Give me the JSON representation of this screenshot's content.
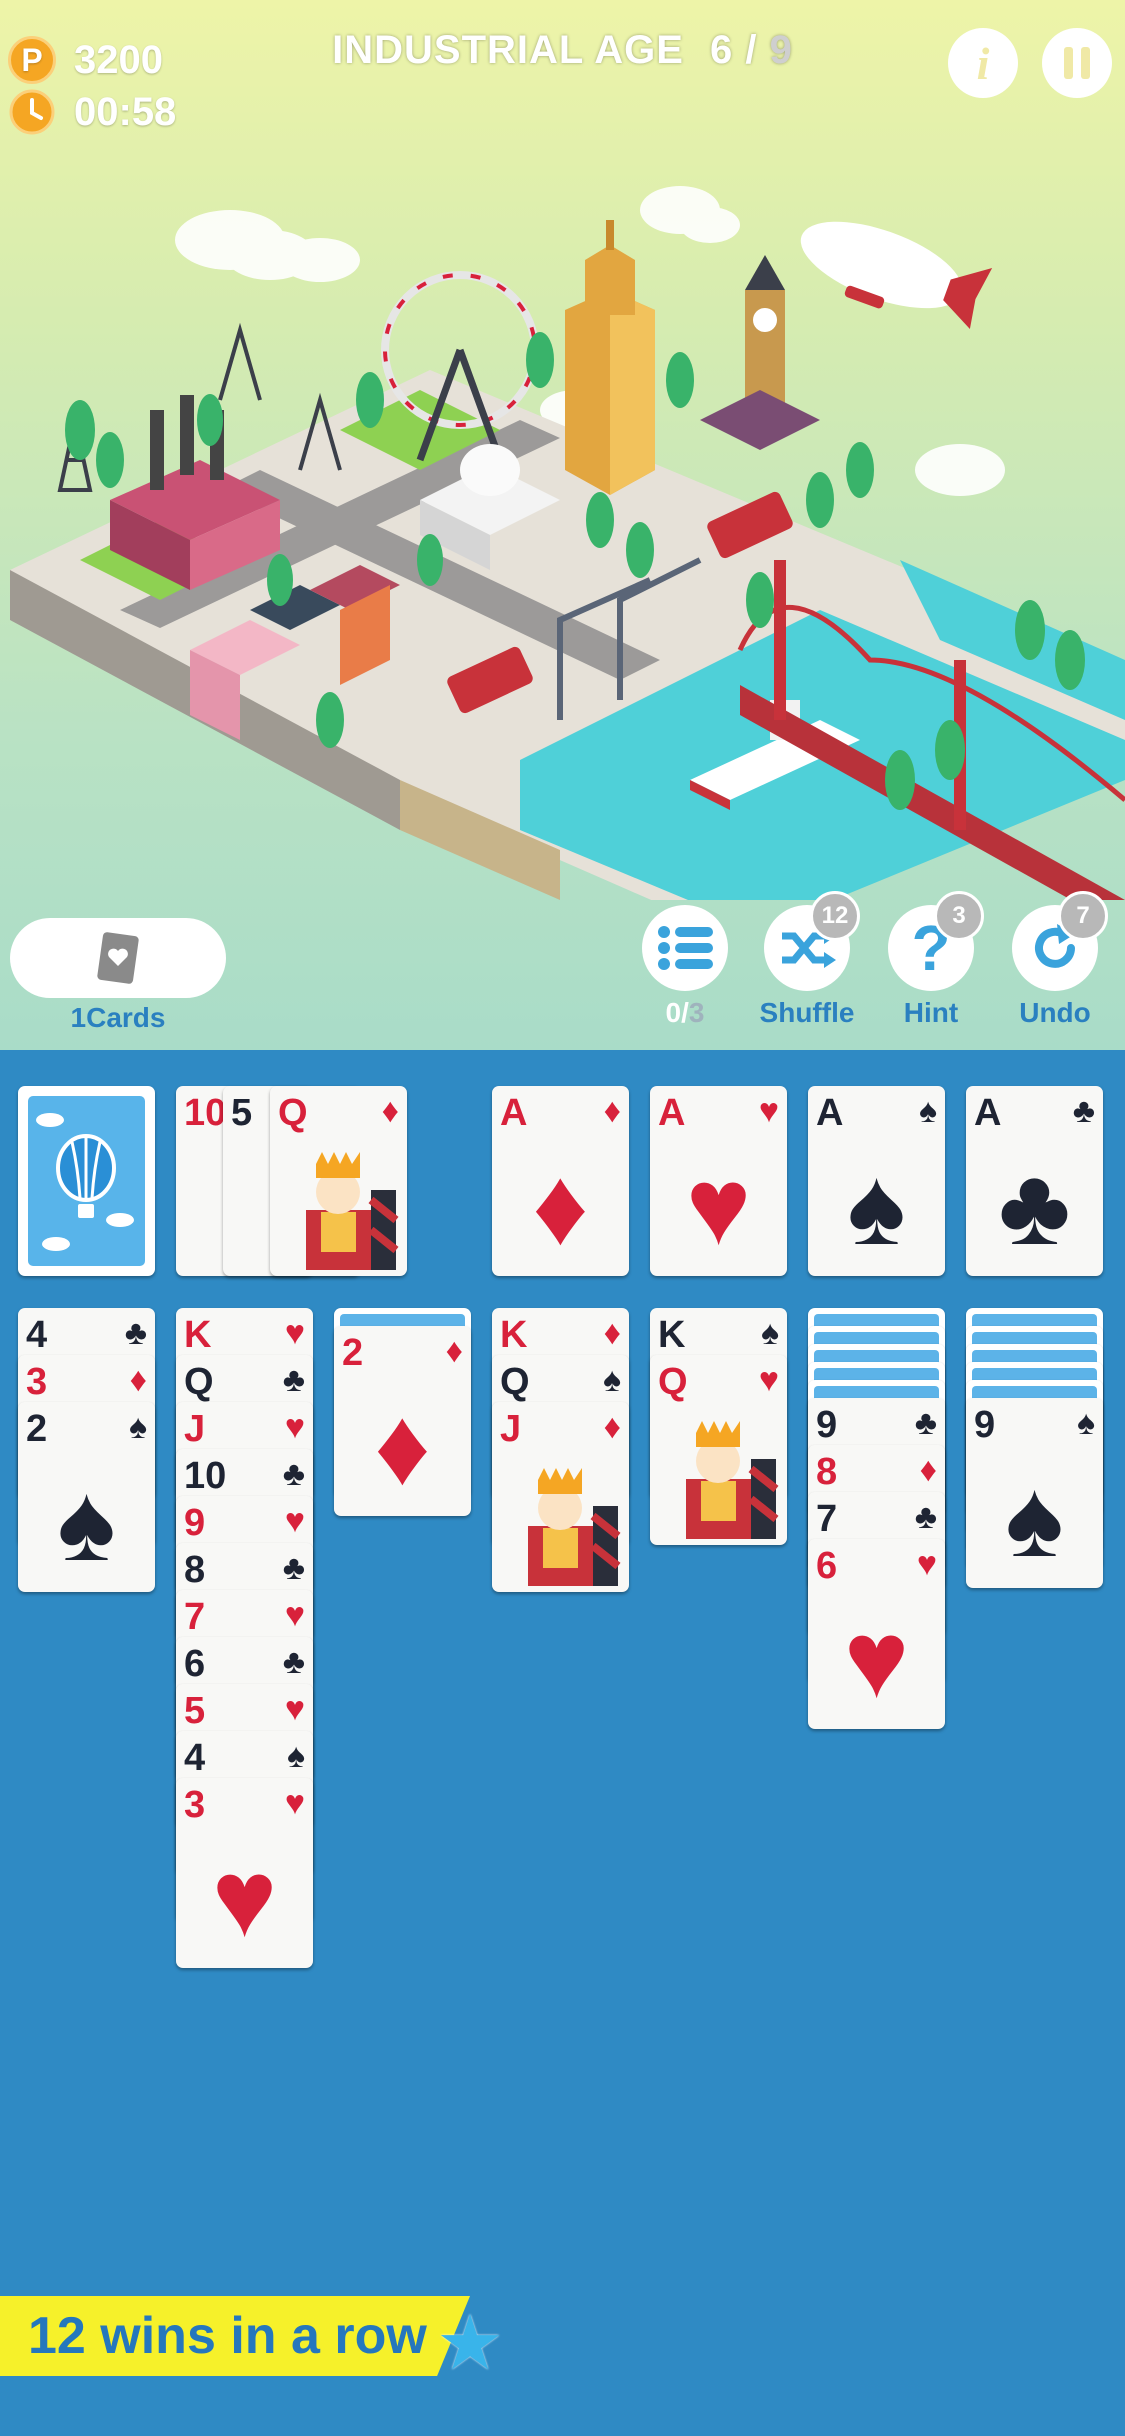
{
  "hud": {
    "coin_icon": "P",
    "coins": "3200",
    "timer": "00:58",
    "level_name": "INDUSTRIAL AGE",
    "level_current": "6",
    "level_sep": " / ",
    "level_total": "9"
  },
  "toolbar": {
    "cards_label": "1Cards",
    "goals_count": "0",
    "goals_sep": "/",
    "goals_total": "3",
    "shuffle_label": "Shuffle",
    "shuffle_badge": "12",
    "hint_label": "Hint",
    "hint_badge": "3",
    "undo_label": "Undo",
    "undo_badge": "7"
  },
  "waste": [
    {
      "rank": "10",
      "suit": "♦",
      "color": "red"
    },
    {
      "rank": "5",
      "suit": "♠",
      "color": "blk"
    },
    {
      "rank": "Q",
      "suit": "♦",
      "color": "red"
    }
  ],
  "foundations": [
    {
      "rank": "A",
      "suit": "♦",
      "color": "red"
    },
    {
      "rank": "A",
      "suit": "♥",
      "color": "red"
    },
    {
      "rank": "A",
      "suit": "♠",
      "color": "blk"
    },
    {
      "rank": "A",
      "suit": "♣",
      "color": "blk"
    }
  ],
  "tableau": [
    {
      "hidden": 0,
      "cards": [
        {
          "rank": "4",
          "suit": "♣",
          "color": "blk"
        },
        {
          "rank": "3",
          "suit": "♦",
          "color": "red"
        },
        {
          "rank": "2",
          "suit": "♠",
          "color": "blk"
        }
      ]
    },
    {
      "hidden": 0,
      "cards": [
        {
          "rank": "K",
          "suit": "♥",
          "color": "red"
        },
        {
          "rank": "Q",
          "suit": "♣",
          "color": "blk"
        },
        {
          "rank": "J",
          "suit": "♥",
          "color": "red"
        },
        {
          "rank": "10",
          "suit": "♣",
          "color": "blk"
        },
        {
          "rank": "9",
          "suit": "♥",
          "color": "red"
        },
        {
          "rank": "8",
          "suit": "♣",
          "color": "blk"
        },
        {
          "rank": "7",
          "suit": "♥",
          "color": "red"
        },
        {
          "rank": "6",
          "suit": "♣",
          "color": "blk"
        },
        {
          "rank": "5",
          "suit": "♥",
          "color": "red"
        },
        {
          "rank": "4",
          "suit": "♠",
          "color": "blk"
        },
        {
          "rank": "3",
          "suit": "♥",
          "color": "red"
        }
      ]
    },
    {
      "hidden": 1,
      "cards": [
        {
          "rank": "2",
          "suit": "♦",
          "color": "red"
        }
      ]
    },
    {
      "hidden": 0,
      "cards": [
        {
          "rank": "K",
          "suit": "♦",
          "color": "red"
        },
        {
          "rank": "Q",
          "suit": "♠",
          "color": "blk"
        },
        {
          "rank": "J",
          "suit": "♦",
          "color": "red"
        }
      ]
    },
    {
      "hidden": 0,
      "cards": [
        {
          "rank": "K",
          "suit": "♠",
          "color": "blk"
        },
        {
          "rank": "Q",
          "suit": "♥",
          "color": "red"
        }
      ]
    },
    {
      "hidden": 5,
      "cards": [
        {
          "rank": "9",
          "suit": "♣",
          "color": "blk"
        },
        {
          "rank": "8",
          "suit": "♦",
          "color": "red"
        },
        {
          "rank": "7",
          "suit": "♣",
          "color": "blk"
        },
        {
          "rank": "6",
          "suit": "♥",
          "color": "red"
        }
      ]
    },
    {
      "hidden": 5,
      "cards": [
        {
          "rank": "9",
          "suit": "♠",
          "color": "blk"
        }
      ]
    }
  ],
  "streak": {
    "text": "12 wins in a row"
  },
  "colors": {
    "table": "#2f8ac4",
    "accent_blue": "#2a80c0",
    "red_suit": "#d8213b",
    "black_suit": "#1e2433",
    "streak_bg": "#f6f12a"
  }
}
